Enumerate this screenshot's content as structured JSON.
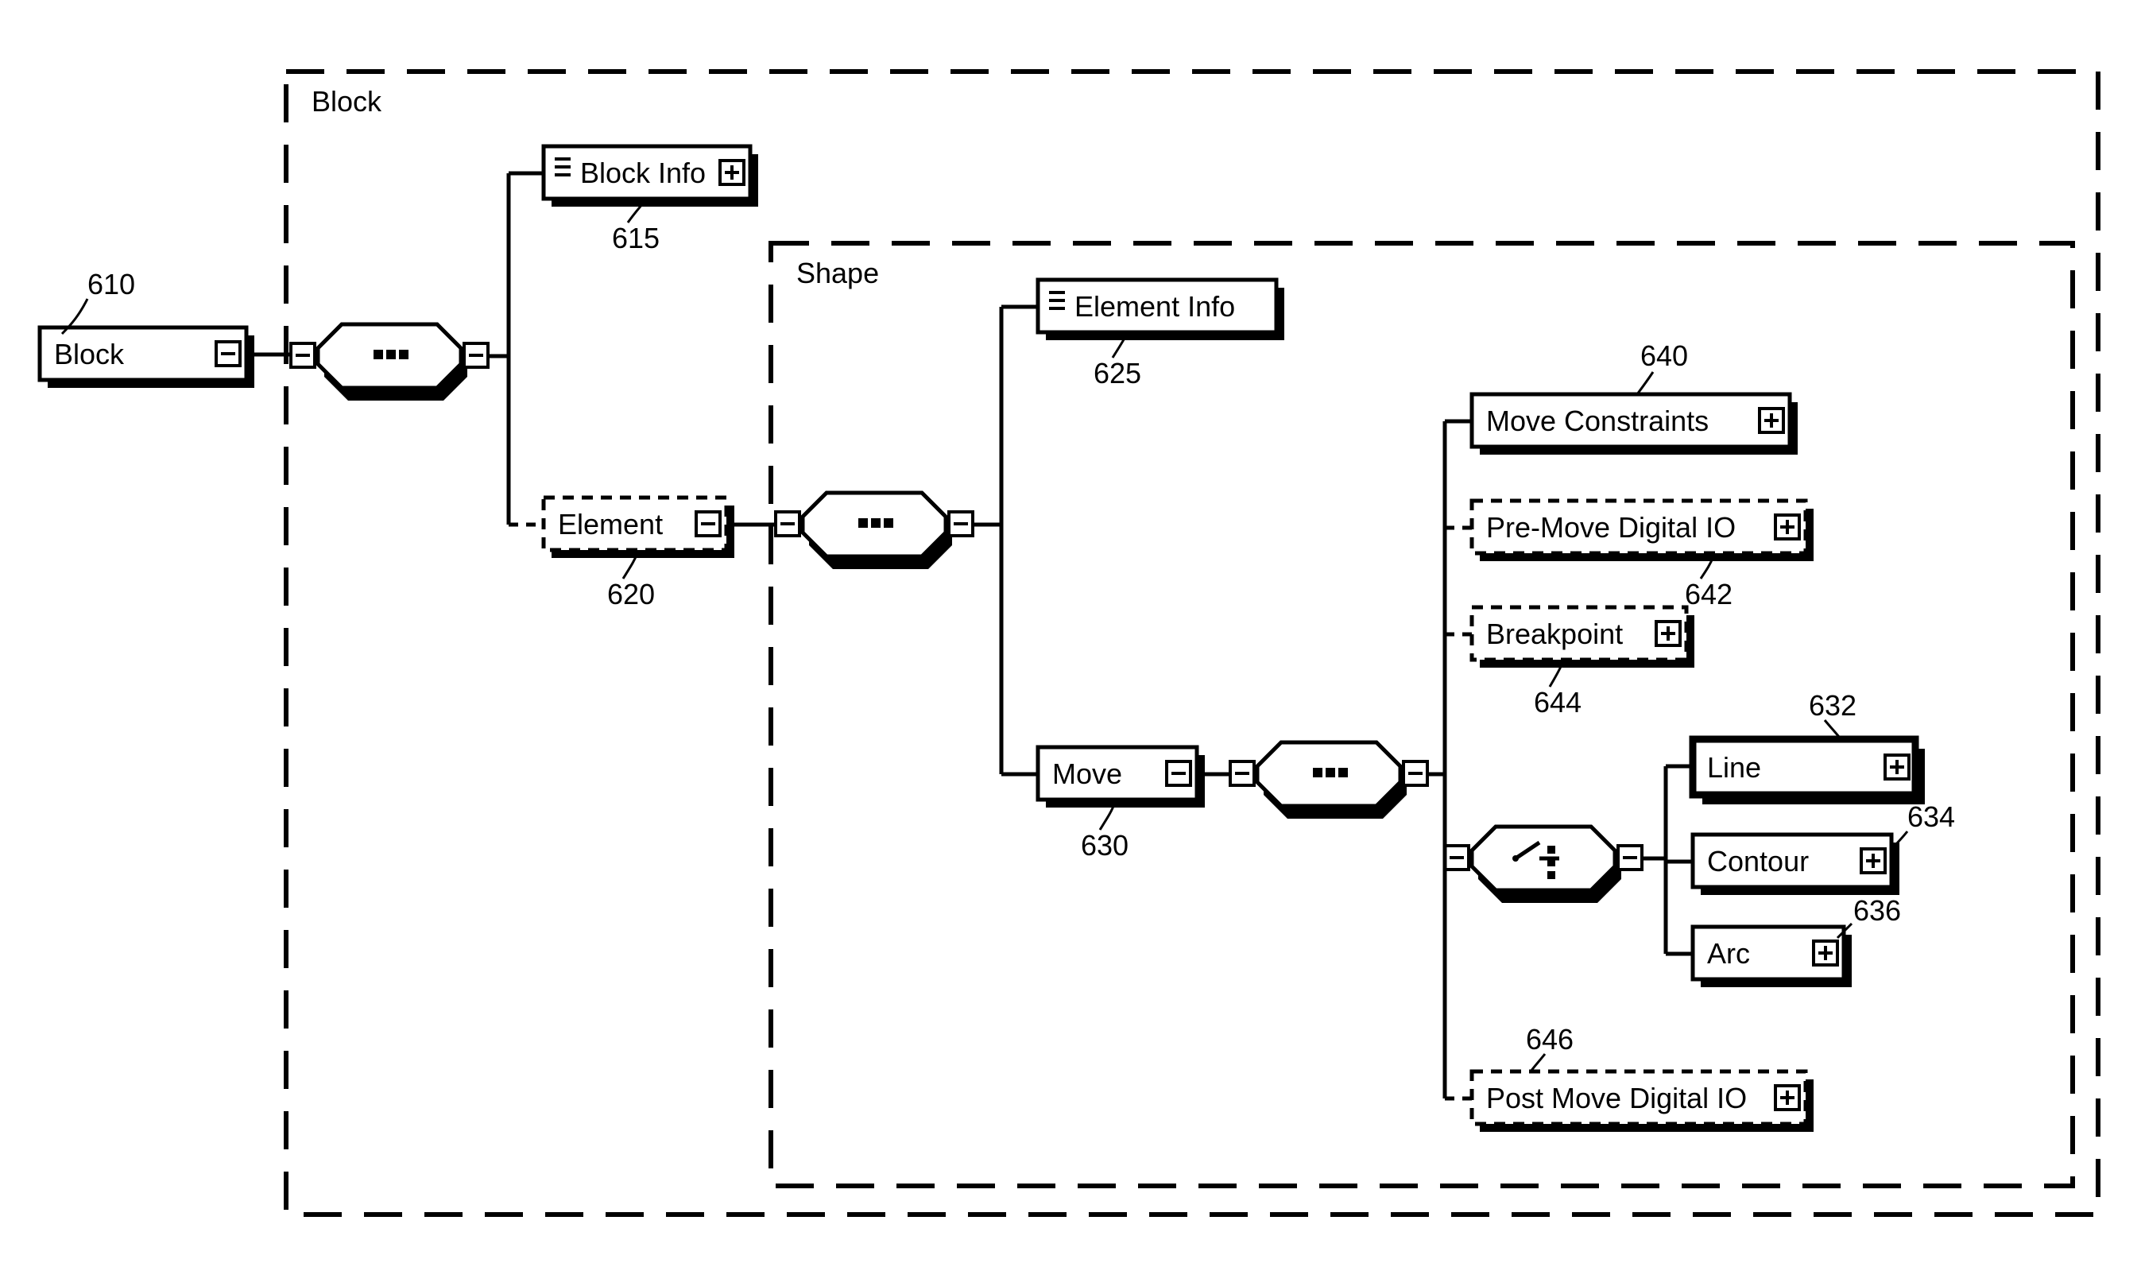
{
  "frames": {
    "block": "Block",
    "shape": "Shape"
  },
  "nodes": {
    "block": "Block",
    "block_info": "Block Info",
    "element": "Element",
    "element_info": "Element Info",
    "move": "Move",
    "move_constraints": "Move Constraints",
    "pre_move_dio": "Pre-Move Digital IO",
    "breakpoint": "Breakpoint",
    "line": "Line",
    "contour": "Contour",
    "arc": "Arc",
    "post_move_dio": "Post Move Digital IO"
  },
  "refs": {
    "block": "610",
    "block_info": "615",
    "element": "620",
    "element_info": "625",
    "move": "630",
    "line": "632",
    "contour": "634",
    "arc": "636",
    "move_constraints": "640",
    "pre_move_dio": "642",
    "breakpoint": "644",
    "post_move_dio": "646"
  }
}
